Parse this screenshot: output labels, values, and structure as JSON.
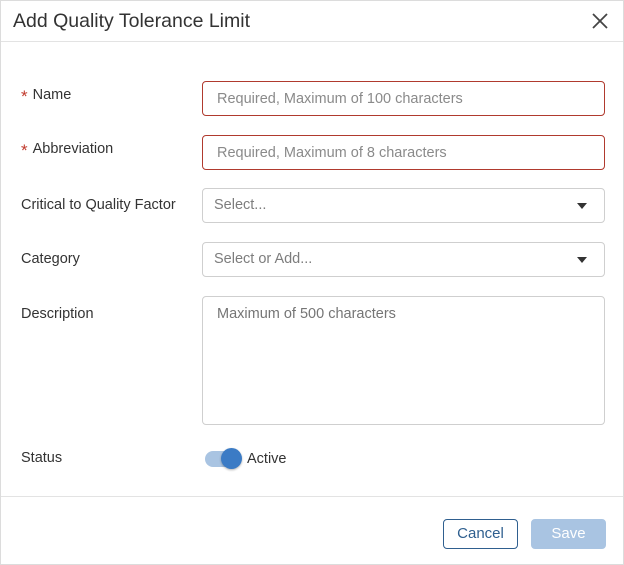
{
  "dialog": {
    "title": "Add Quality Tolerance Limit",
    "close_icon": "close-icon"
  },
  "form": {
    "name": {
      "label": "Name",
      "required_marker": "*",
      "value": "",
      "placeholder": "Required, Maximum of 100 characters"
    },
    "abbreviation": {
      "label": "Abbreviation",
      "required_marker": "*",
      "value": "",
      "placeholder": "Required, Maximum of 8 characters"
    },
    "ctq_factor": {
      "label": "Critical to Quality Factor",
      "selected": "Select...",
      "icon": "caret-down-icon"
    },
    "category": {
      "label": "Category",
      "selected": "Select or Add...",
      "icon": "caret-down-icon"
    },
    "description": {
      "label": "Description",
      "value": "",
      "placeholder": "Maximum of 500 characters"
    },
    "status": {
      "label": "Status",
      "toggle_on": true,
      "toggle_text": "Active"
    }
  },
  "footer": {
    "cancel_label": "Cancel",
    "save_label": "Save"
  },
  "colors": {
    "required_marker": "#c0392b",
    "error_border": "#b03a2e",
    "toggle_knob": "#3b7bc5",
    "toggle_track": "#a9c4e2",
    "primary_outline": "#2f5f8f",
    "save_disabled": "#a9c4e2"
  }
}
